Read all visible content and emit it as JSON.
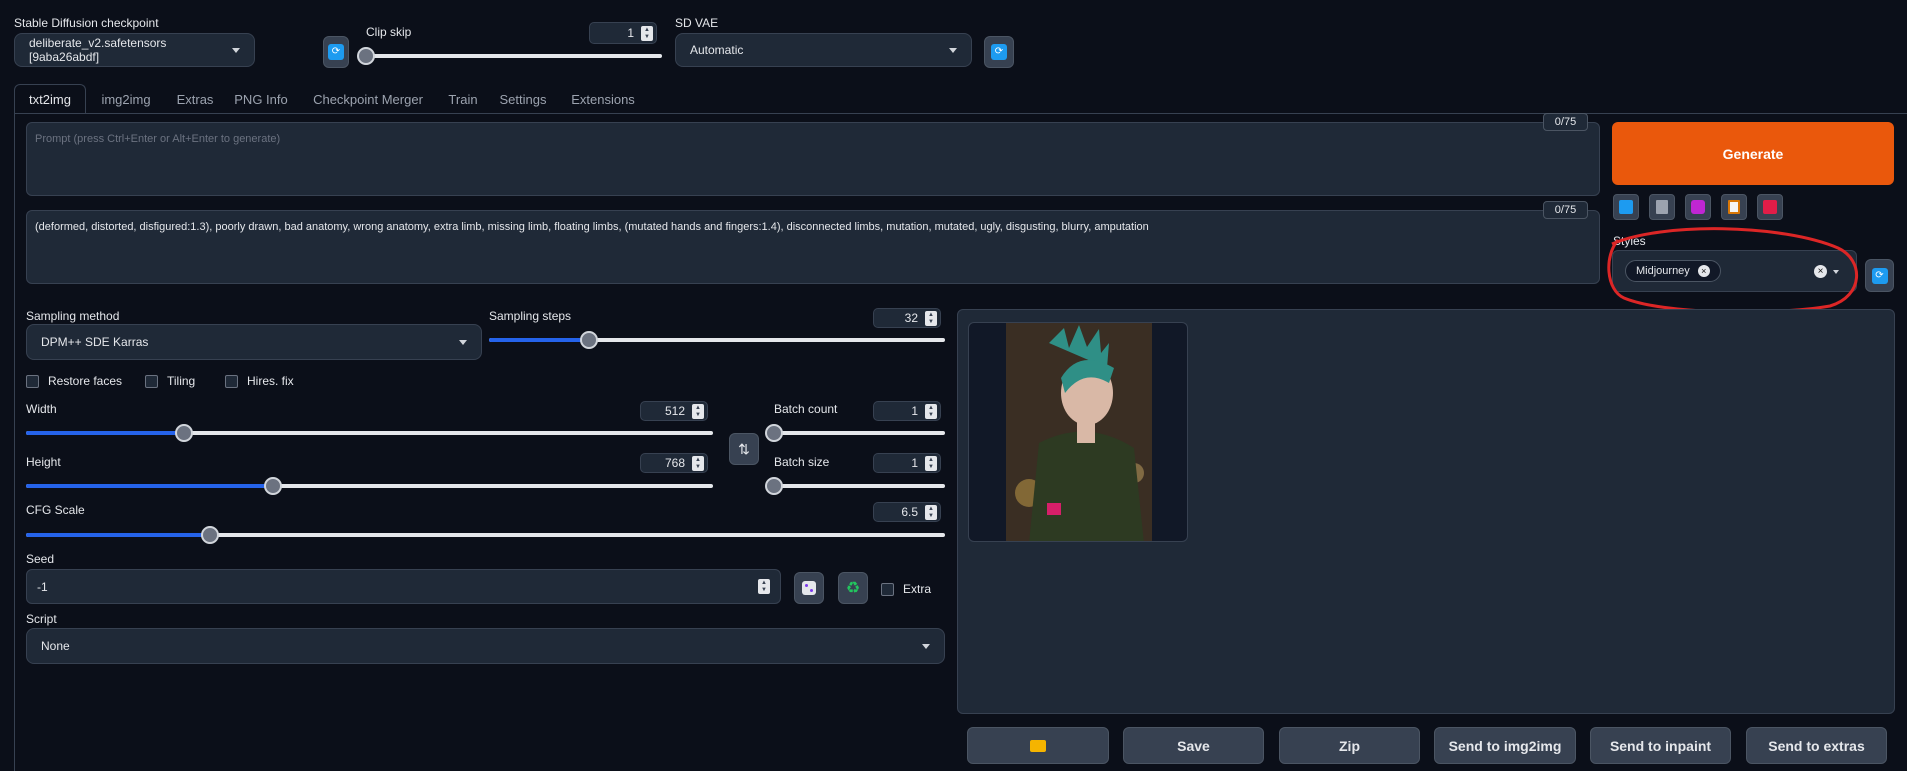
{
  "top": {
    "checkpoint_label": "Stable Diffusion checkpoint",
    "checkpoint_value": "deliberate_v2.safetensors [9aba26abdf]",
    "clipskip_label": "Clip skip",
    "clipskip_value": "1",
    "clipskip_fraction": 0,
    "vae_label": "SD VAE",
    "vae_value": "Automatic"
  },
  "tabs": [
    "txt2img",
    "img2img",
    "Extras",
    "PNG Info",
    "Checkpoint Merger",
    "Train",
    "Settings",
    "Extensions"
  ],
  "active_tab": 0,
  "prompt": {
    "placeholder": "Prompt (press Ctrl+Enter or Alt+Enter to generate)",
    "counter": "0/75"
  },
  "negative": {
    "value": "(deformed, distorted, disfigured:1.3), poorly drawn, bad anatomy, wrong anatomy, extra limb, missing limb, floating limbs, (mutated hands and fingers:1.4), disconnected limbs, mutation, mutated, ugly, disgusting, blurry, amputation",
    "counter": "0/75"
  },
  "generate_label": "Generate",
  "tool_icons": [
    "paste-icon",
    "trash-icon",
    "style-icon",
    "clipboard-icon",
    "save-icon"
  ],
  "styles": {
    "label": "Styles",
    "chip": "Midjourney"
  },
  "sampling": {
    "method_label": "Sampling method",
    "method_value": "DPM++ SDE Karras",
    "steps_label": "Sampling steps",
    "steps_value": "32",
    "steps_fraction": 0.22
  },
  "checks": {
    "restore_faces": "Restore faces",
    "tiling": "Tiling",
    "hires": "Hires. fix"
  },
  "width": {
    "label": "Width",
    "value": "512",
    "fraction": 0.23
  },
  "height": {
    "label": "Height",
    "value": "768",
    "fraction": 0.36
  },
  "batch_count": {
    "label": "Batch count",
    "value": "1",
    "fraction": 0
  },
  "batch_size": {
    "label": "Batch size",
    "value": "1",
    "fraction": 0
  },
  "cfg": {
    "label": "CFG Scale",
    "value": "6.5",
    "fraction": 0.2
  },
  "seed": {
    "label": "Seed",
    "value": "-1",
    "extra_label": "Extra"
  },
  "script": {
    "label": "Script",
    "value": "None"
  },
  "output_buttons": {
    "save": "Save",
    "zip": "Zip",
    "send_img2img": "Send to img2img",
    "send_inpaint": "Send to inpaint",
    "send_extras": "Send to extras"
  },
  "colors": {
    "generate": "#ea580c",
    "accent": "#2563eb",
    "annotation": "#dc2626"
  }
}
